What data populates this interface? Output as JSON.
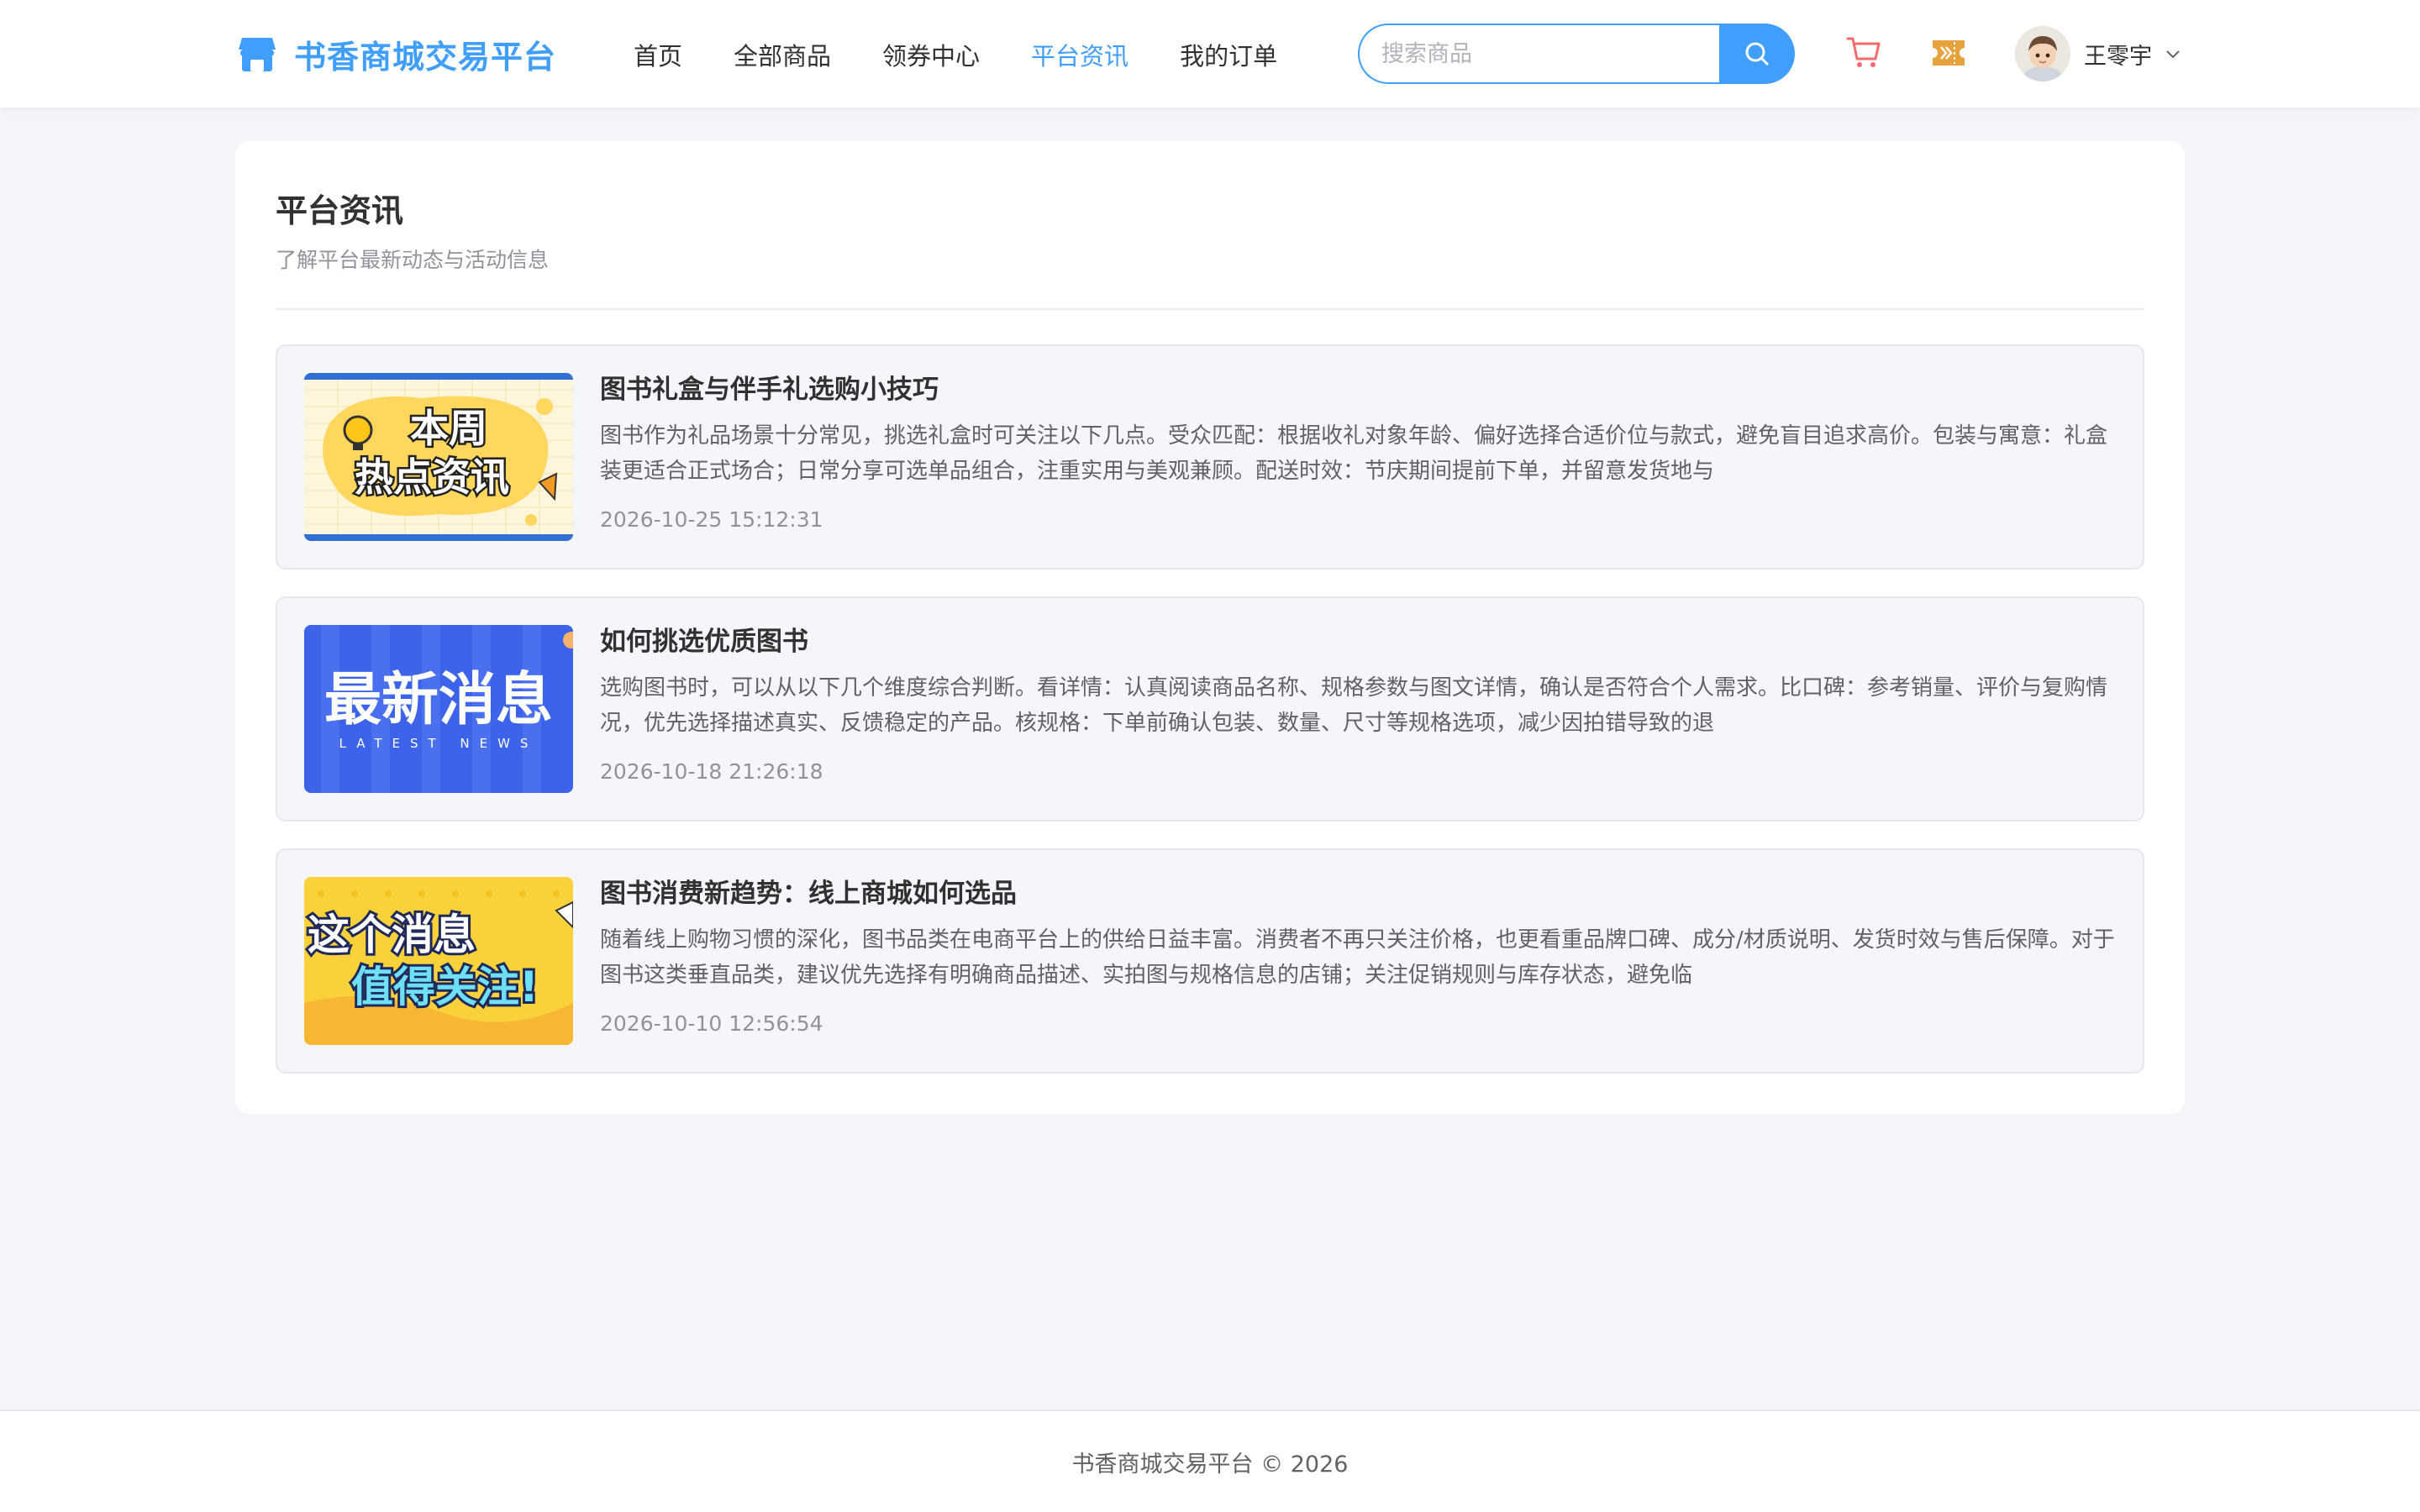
{
  "header": {
    "brand_title": "书香商城交易平台",
    "nav": [
      {
        "label": "首页",
        "active": false
      },
      {
        "label": "全部商品",
        "active": false
      },
      {
        "label": "领券中心",
        "active": false
      },
      {
        "label": "平台资讯",
        "active": true
      },
      {
        "label": "我的订单",
        "active": false
      }
    ],
    "search": {
      "placeholder": "搜索商品",
      "value": ""
    },
    "user": {
      "name": "王零宇"
    }
  },
  "page": {
    "title": "平台资讯",
    "subtitle": "了解平台最新动态与活动信息"
  },
  "news": [
    {
      "title": "图书礼盒与伴手礼选购小技巧",
      "summary": "图书作为礼品场景十分常见，挑选礼盒时可关注以下几点。受众匹配：根据收礼对象年龄、偏好选择合适价位与款式，避免盲目追求高价。包装与寓意：礼盒装更适合正式场合；日常分享可选单品组合，注重实用与美观兼顾。配送时效：节庆期间提前下单，并留意发货地与",
      "time": "2026-10-25 15:12:31",
      "thumb_text": [
        "本周",
        "热点资讯"
      ]
    },
    {
      "title": "如何挑选优质图书",
      "summary": "选购图书时，可以从以下几个维度综合判断。看详情：认真阅读商品名称、规格参数与图文详情，确认是否符合个人需求。比口碑：参考销量、评价与复购情况，优先选择描述真实、反馈稳定的产品。核规格：下单前确认包装、数量、尺寸等规格选项，减少因拍错导致的退",
      "time": "2026-10-18 21:26:18",
      "thumb_text": [
        "最新消息",
        "LATEST NEWS"
      ]
    },
    {
      "title": "图书消费新趋势：线上商城如何选品",
      "summary": "随着线上购物习惯的深化，图书品类在电商平台上的供给日益丰富。消费者不再只关注价格，也更看重品牌口碑、成分/材质说明、发货时效与售后保障。对于图书这类垂直品类，建议优先选择有明确商品描述、实拍图与规格信息的店铺；关注促销规则与库存状态，避免临",
      "time": "2026-10-10 12:56:54",
      "thumb_text": [
        "这个消息",
        "值得关注!"
      ]
    }
  ],
  "footer": {
    "text": "书香商城交易平台 © 2026"
  },
  "colors": {
    "accent": "#409eff",
    "cart_icon": "#f56c6c",
    "coupon_icon": "#e6a23c",
    "page_bg": "#f4f5f9"
  },
  "icons": {
    "brand": "shop-icon",
    "search": "search-icon",
    "cart": "cart-icon",
    "coupon": "coupon-icon",
    "dropdown": "chevron-down-icon"
  }
}
